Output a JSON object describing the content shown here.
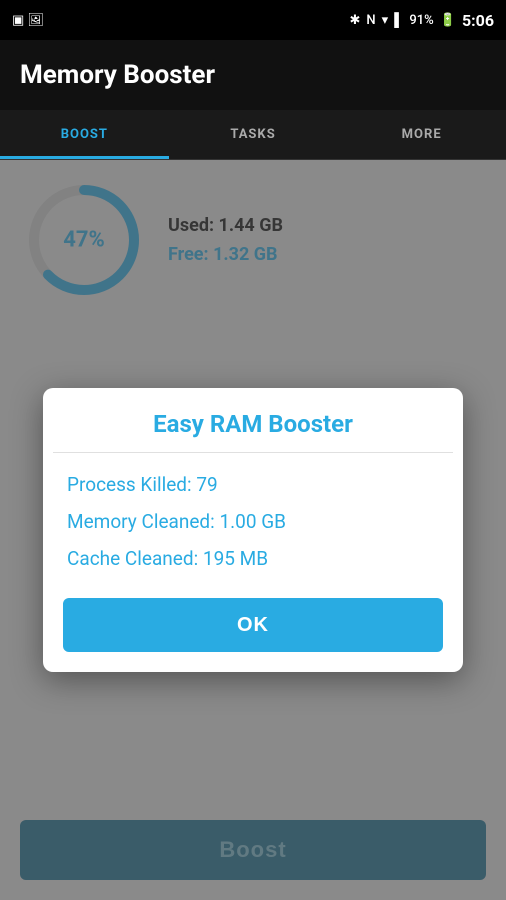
{
  "statusBar": {
    "time": "5:06",
    "battery": "91%",
    "icons": [
      "bluetooth",
      "wifi-n",
      "wifi-signal",
      "signal-bars"
    ]
  },
  "header": {
    "title": "Memory Booster"
  },
  "tabs": [
    {
      "id": "boost",
      "label": "BOOST",
      "active": true
    },
    {
      "id": "tasks",
      "label": "TASKS",
      "active": false
    },
    {
      "id": "more",
      "label": "MORE",
      "active": false
    }
  ],
  "memoryStats": {
    "percentage": "47%",
    "used_label": "Used: ",
    "used_value": "1.44 GB",
    "free_label": "Free: ",
    "free_value": "1.32 GB",
    "circle_color": "#29abe2",
    "circle_bg": "#ccc"
  },
  "boostButton": {
    "label": "Boost"
  },
  "dialog": {
    "title": "Easy RAM Booster",
    "stats": [
      {
        "label": "Process Killed: ",
        "value": "79"
      },
      {
        "label": "Memory Cleaned: ",
        "value": "1.00 GB"
      },
      {
        "label": "Cache Cleaned: ",
        "value": "195 MB"
      }
    ],
    "ok_label": "OK"
  }
}
